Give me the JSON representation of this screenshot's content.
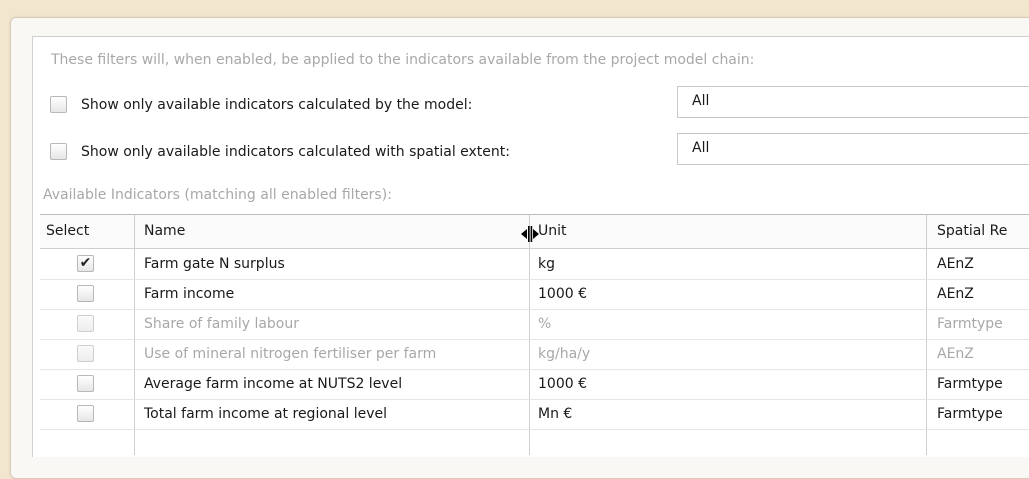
{
  "filters": {
    "intro": "These filters will, when enabled, be applied to the indicators available from the project model chain:",
    "model_filter": {
      "label": "Show only available indicators calculated by the model:",
      "value": "All",
      "checked": false
    },
    "spatial_filter": {
      "label": "Show only available indicators calculated with spatial extent:",
      "value": "All",
      "checked": false
    }
  },
  "indicators": {
    "caption": "Available Indicators (matching all enabled filters):",
    "columns": {
      "select": "Select",
      "name": "Name",
      "unit": "Unit",
      "spatial": "Spatial Re"
    },
    "rows": [
      {
        "checked": true,
        "check_glyph": "✔",
        "name": "Farm gate N surplus",
        "unit": "kg",
        "spatial": "AEnZ",
        "enabled": true
      },
      {
        "checked": false,
        "check_glyph": "",
        "name": "Farm income",
        "unit": "1000 €",
        "spatial": "AEnZ",
        "enabled": true
      },
      {
        "checked": false,
        "check_glyph": "",
        "name": "Share of family labour",
        "unit": "%",
        "spatial": "Farmtype",
        "enabled": false
      },
      {
        "checked": false,
        "check_glyph": "",
        "name": "Use of mineral nitrogen fertiliser per farm",
        "unit": "kg/ha/y",
        "spatial": "AEnZ",
        "enabled": false
      },
      {
        "checked": false,
        "check_glyph": "",
        "name": "Average farm income at NUTS2 level",
        "unit": "1000 €",
        "spatial": "Farmtype",
        "enabled": true
      },
      {
        "checked": false,
        "check_glyph": "",
        "name": "Total farm income at regional level",
        "unit": "Mn €",
        "spatial": "Farmtype",
        "enabled": true
      }
    ]
  },
  "cursor": {
    "icon": "column-resize-cursor-icon"
  }
}
